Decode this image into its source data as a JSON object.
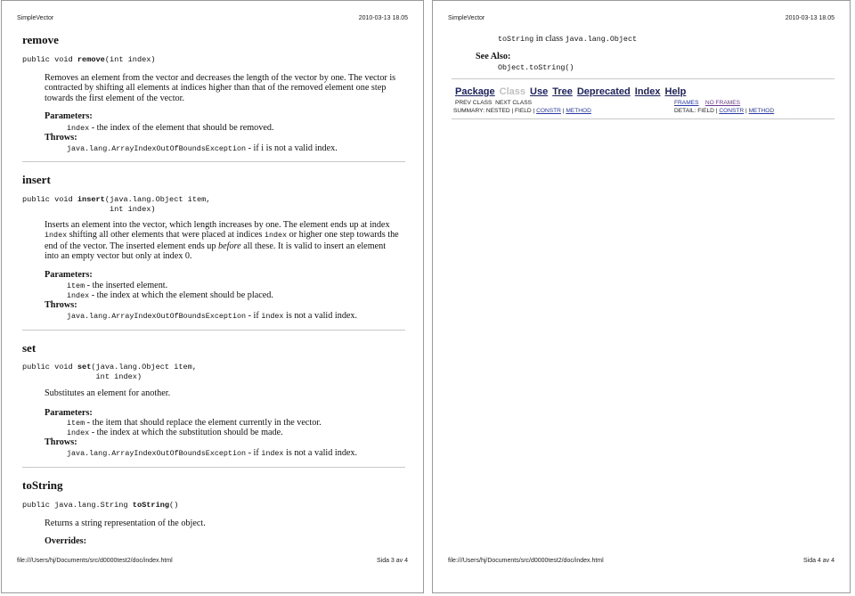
{
  "header": {
    "title": "SimpleVector",
    "timestamp": "2010-03-13 18.05"
  },
  "pages": [
    {
      "footer": {
        "url": "file:///Users/hj/Documents/src/d0000test2/doc/index.html",
        "page_label": "Sida 3 av 4"
      },
      "methods": {
        "remove": {
          "name": "remove",
          "sig_prefix": "public void ",
          "sig_name": "remove",
          "sig_suffix": "(int index)",
          "description": "Removes an element from the vector and decreases the length of the vector by one. The vector is contracted by shifting all elements at indices higher than that of the removed element one step towards the first element of the vector.",
          "params_label": "Parameters:",
          "params": [
            {
              "name": "index",
              "text": " - the index of the element that should be removed."
            }
          ],
          "throws_label": "Throws:",
          "throws": {
            "name": "java.lang.ArrayIndexOutOfBoundsException",
            "text": " - if i is not a valid index."
          }
        },
        "insert": {
          "name": "insert",
          "sig_prefix": "public void ",
          "sig_name": "insert",
          "sig_suffix": "(java.lang.Object item,",
          "sig_line2": "                   int index)",
          "desc_parts": [
            "Inserts an element into the vector, which length increases by one. The element ends up at index ",
            "index",
            " shifting all other elements that were placed at indices ",
            "index",
            " or higher one step towards the end of the vector. The inserted element ends up ",
            "before",
            " all these. It is valid to insert an element into an empty vector but only at index 0."
          ],
          "params_label": "Parameters:",
          "params": [
            {
              "name": "item",
              "text": " - the inserted element."
            },
            {
              "name": "index",
              "text": " - the index at which the element should be placed."
            }
          ],
          "throws_label": "Throws:",
          "throws": {
            "name": "java.lang.ArrayIndexOutOfBoundsException",
            "text_pre": " - if ",
            "code": "index",
            "text_post": " is not a valid index."
          }
        },
        "set": {
          "name": "set",
          "sig_prefix": "public void ",
          "sig_name": "set",
          "sig_suffix": "(java.lang.Object item,",
          "sig_line2": "                int index)",
          "description": "Substitutes an element for another.",
          "params_label": "Parameters:",
          "params": [
            {
              "name": "item",
              "text": " - the item that should replace the element currently in the vector."
            },
            {
              "name": "index",
              "text": " - the index at which the substitution should be made."
            }
          ],
          "throws_label": "Throws:",
          "throws": {
            "name": "java.lang.ArrayIndexOutOfBoundsException",
            "text_pre": " - if ",
            "code": "index",
            "text_post": " is not a valid index."
          }
        },
        "tostring": {
          "name": "toString",
          "sig_prefix": "public java.lang.String ",
          "sig_name": "toString",
          "sig_suffix": "()",
          "description": "Returns a string representation of the object.",
          "overrides_label": "Overrides:"
        }
      }
    },
    {
      "footer": {
        "url": "file:///Users/hj/Documents/src/d0000test2/doc/index.html",
        "page_label": "Sida 4 av 4"
      },
      "overrides": {
        "method": "toString",
        "in_class": " in class ",
        "class": "java.lang.Object"
      },
      "see_also_label": "See Also:",
      "see_also": "Object.toString()",
      "nav": {
        "items": [
          {
            "label": "Package",
            "current": false
          },
          {
            "label": "Class",
            "current": true
          },
          {
            "label": "Use",
            "current": false
          },
          {
            "label": "Tree",
            "current": false
          },
          {
            "label": "Deprecated",
            "current": false
          },
          {
            "label": "Index",
            "current": false
          },
          {
            "label": "Help",
            "current": false
          }
        ],
        "prev_class": "PREV CLASS",
        "next_class": "NEXT CLASS",
        "frames": "FRAMES",
        "no_frames": "NO FRAMES",
        "summary_label": "SUMMARY: NESTED | FIELD | ",
        "summary_constr": "CONSTR",
        "sep": " | ",
        "summary_method": "METHOD",
        "detail_label": "DETAIL: FIELD | ",
        "detail_constr": "CONSTR",
        "detail_method": "METHOD"
      }
    }
  ]
}
